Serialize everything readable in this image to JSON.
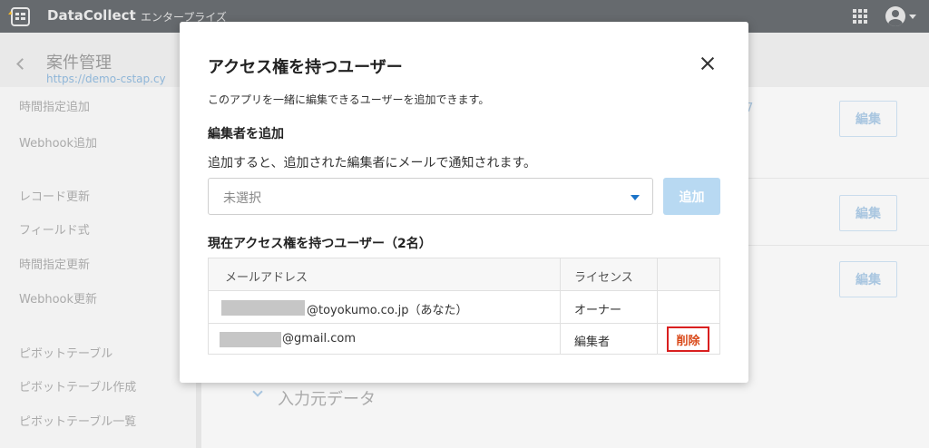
{
  "header": {
    "brand": "DataCollect",
    "edition": "エンタープライズ"
  },
  "page": {
    "title": "案件管理",
    "url": "https://demo-cstap.cy"
  },
  "sidebar": {
    "items": [
      {
        "label": "時間指定追加"
      },
      {
        "label": "Webhook追加"
      },
      {
        "label": "レコード更新"
      },
      {
        "label": "フィールド式"
      },
      {
        "label": "時間指定更新"
      },
      {
        "label": "Webhook更新"
      },
      {
        "label": "ピボットテーブル"
      },
      {
        "label": "ピボットテーブル作成"
      },
      {
        "label": "ピボットテーブル一覧"
      }
    ]
  },
  "background": {
    "edit_label": "編集",
    "partial_link": "7",
    "section_title": "入力元データ"
  },
  "modal": {
    "title": "アクセス権を持つユーザー",
    "description": "このアプリを一緒に編集できるユーザーを追加できます。",
    "add_editor_label": "編集者を追加",
    "notify_text": "追加すると、追加された編集者にメールで通知されます。",
    "select_value": "未選択",
    "add_button": "追加",
    "current_label": "現在アクセス権を持つユーザー（2名）",
    "table": {
      "columns": [
        "メールアドレス",
        "ライセンス",
        ""
      ],
      "rows": [
        {
          "email": "@toyokumo.co.jp（あなた）",
          "license": "オーナー",
          "action": ""
        },
        {
          "email": "@gmail.com",
          "license": "編集者",
          "action": "削除"
        }
      ]
    }
  },
  "colors": {
    "topbar": "#666a6e",
    "accent": "#1a73c8",
    "danger": "#d91f1f"
  }
}
